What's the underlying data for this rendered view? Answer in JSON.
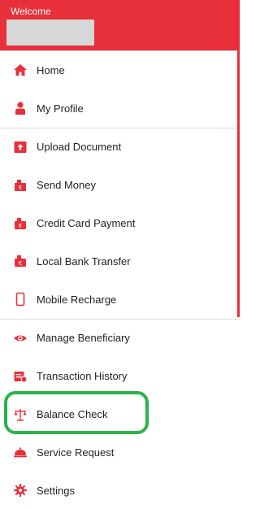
{
  "header": {
    "welcome_label": "Welcome"
  },
  "colors": {
    "accent": "#e8303a",
    "highlight": "#2bb34a"
  },
  "menu": {
    "items": [
      {
        "label": "Home",
        "icon": "home-icon"
      },
      {
        "label": "My Profile",
        "icon": "person-icon"
      },
      {
        "label": "Upload Document",
        "icon": "upload-document-icon"
      },
      {
        "label": "Send Money",
        "icon": "send-money-icon"
      },
      {
        "label": "Credit Card Payment",
        "icon": "credit-card-icon"
      },
      {
        "label": "Local Bank Transfer",
        "icon": "bank-transfer-icon"
      },
      {
        "label": "Mobile Recharge",
        "icon": "mobile-icon"
      },
      {
        "label": "Manage Beneficiary",
        "icon": "eye-icon"
      },
      {
        "label": "Transaction History",
        "icon": "history-icon"
      },
      {
        "label": "Balance Check",
        "icon": "scale-icon"
      },
      {
        "label": "Service Request",
        "icon": "service-bell-icon"
      },
      {
        "label": "Settings",
        "icon": "gear-icon"
      }
    ]
  }
}
